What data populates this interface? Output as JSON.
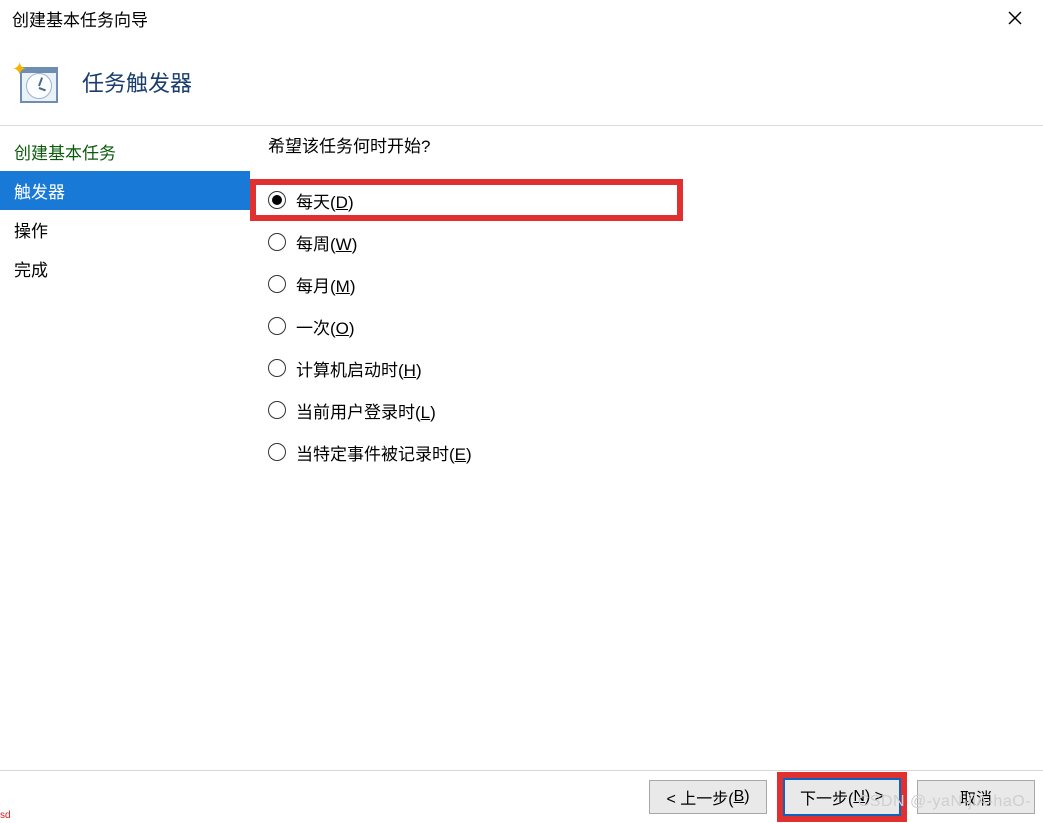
{
  "window": {
    "title": "创建基本任务向导"
  },
  "header": {
    "heading": "任务触发器"
  },
  "sidebar": {
    "items": [
      {
        "label": "创建基本任务",
        "state": "completed"
      },
      {
        "label": "触发器",
        "state": "active"
      },
      {
        "label": "操作",
        "state": "pending"
      },
      {
        "label": "完成",
        "state": "pending"
      }
    ]
  },
  "content": {
    "prompt": "希望该任务何时开始?",
    "options": [
      {
        "text": "每天",
        "accel": "D",
        "selected": true,
        "highlighted": true
      },
      {
        "text": "每周",
        "accel": "W",
        "selected": false,
        "highlighted": false
      },
      {
        "text": "每月",
        "accel": "M",
        "selected": false,
        "highlighted": false
      },
      {
        "text": "一次",
        "accel": "O",
        "selected": false,
        "highlighted": false
      },
      {
        "text": "计算机启动时",
        "accel": "H",
        "selected": false,
        "highlighted": false
      },
      {
        "text": "当前用户登录时",
        "accel": "L",
        "selected": false,
        "highlighted": false
      },
      {
        "text": "当特定事件被记录时",
        "accel": "E",
        "selected": false,
        "highlighted": false
      }
    ]
  },
  "footer": {
    "back": {
      "prefix": "< 上一步(",
      "accel": "B",
      "suffix": ")"
    },
    "next": {
      "prefix": "下一步(",
      "accel": "N",
      "suffix": ") >",
      "highlighted": true
    },
    "cancel": {
      "label": "取消"
    }
  },
  "watermark": "CSDN @-yaN-jiA-haO-",
  "corner": "sd"
}
